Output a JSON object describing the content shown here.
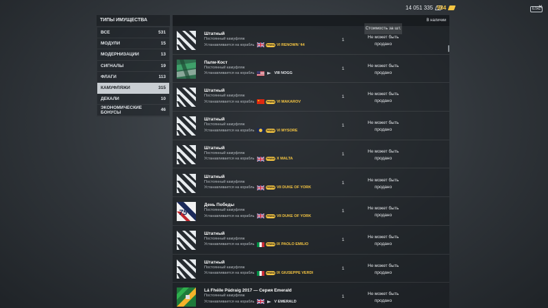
{
  "header": {
    "credits": "14 051 335",
    "gold": "984",
    "esc_label": "ESC",
    "close_symbol": "×"
  },
  "sidebar": {
    "title": "ТИПЫ ИМУЩЕСТВА",
    "items": [
      {
        "label": "ВСЕ",
        "count": "531",
        "active": false
      },
      {
        "label": "МОДУЛИ",
        "count": "15",
        "active": false
      },
      {
        "label": "МОДЕРНИЗАЦИИ",
        "count": "13",
        "active": false
      },
      {
        "label": "СИГНАЛЫ",
        "count": "19",
        "active": false
      },
      {
        "label": "ФЛАГИ",
        "count": "113",
        "active": false
      },
      {
        "label": "КАМУФЛЯЖИ",
        "count": "315",
        "active": true
      },
      {
        "label": "ДЕКАЛИ",
        "count": "10",
        "active": false
      },
      {
        "label": "ЭКОНОМИЧЕСКИЕ БОНУСЫ",
        "count": "46",
        "active": false
      }
    ]
  },
  "table": {
    "col_available": "В наличии",
    "col_cost": "Стоимость за шт.",
    "rows": [
      {
        "name": "Штатный",
        "type": "Постоянный камуфляж",
        "install": "Устанавливается на корабль",
        "flag": "uk-flag",
        "premium": true,
        "ship": "VI RENOWN '44",
        "qty": "1",
        "cost": "Не может быть продано",
        "thumb": "stripe"
      },
      {
        "name": "Палм-Кост",
        "type": "Постоянный камуфляж",
        "install": "Устанавливается на корабль",
        "flag": "us-flag",
        "premium": false,
        "ship": "VIII NOGG",
        "qty": "1",
        "cost": "Не может быть продано",
        "thumb": "palm"
      },
      {
        "name": "Штатный",
        "type": "Постоянный камуфляж",
        "install": "Устанавливается на корабль",
        "flag": "cn-flag",
        "premium": true,
        "ship": "VI MAKAROV",
        "qty": "1",
        "cost": "Не может быть продано",
        "thumb": "stripe"
      },
      {
        "name": "Штатный",
        "type": "Постоянный камуфляж",
        "install": "Устанавливается на корабль",
        "flag": "commonwealth-flag",
        "premium": true,
        "ship": "VI MYSORE",
        "qty": "1",
        "cost": "Не может быть продано",
        "thumb": "stripe"
      },
      {
        "name": "Штатный",
        "type": "Постоянный камуфляж",
        "install": "Устанавливается на корабль",
        "flag": "uk-flag",
        "premium": true,
        "ship": "X MALTA",
        "qty": "1",
        "cost": "Не может быть продано",
        "thumb": "stripe"
      },
      {
        "name": "Штатный",
        "type": "Постоянный камуфляж",
        "install": "Устанавливается на корабль",
        "flag": "uk-flag",
        "premium": true,
        "ship": "VII DUKE OF YORK",
        "qty": "1",
        "cost": "Не может быть продано",
        "thumb": "stripe"
      },
      {
        "name": "День Победы",
        "type": "Постоянный камуфляж",
        "install": "Устанавливается на корабль",
        "flag": "uk-flag",
        "premium": true,
        "ship": "VII DUKE OF YORK",
        "qty": "1",
        "cost": "Не может быть продано",
        "thumb": "victory"
      },
      {
        "name": "Штатный",
        "type": "Постоянный камуфляж",
        "install": "Устанавливается на корабль",
        "flag": "it-flag",
        "premium": true,
        "ship": "IX PAOLO EMILIO",
        "qty": "1",
        "cost": "Не может быть продано",
        "thumb": "stripe"
      },
      {
        "name": "Штатный",
        "type": "Постоянный камуфляж",
        "install": "Устанавливается на корабль",
        "flag": "it-flag",
        "premium": true,
        "ship": "IX GIUSEPPE VERDI",
        "qty": "1",
        "cost": "Не может быть продано",
        "thumb": "stripe"
      },
      {
        "name": "Lá Fhéile Pádraig 2017 — Серия Emerald",
        "type": "Постоянный камуфляж",
        "install": "Устанавливается на корабль",
        "flag": "uk-flag",
        "premium": false,
        "ship": "V EMERALD",
        "qty": "1",
        "cost": "Не может быть продано",
        "thumb": "emerald"
      }
    ]
  },
  "premium_badge_text": "PREM",
  "colors": {
    "accent_gold": "#f5c542",
    "active_tab_bg": "#c9ced3",
    "text_main": "#e6e9ec"
  }
}
